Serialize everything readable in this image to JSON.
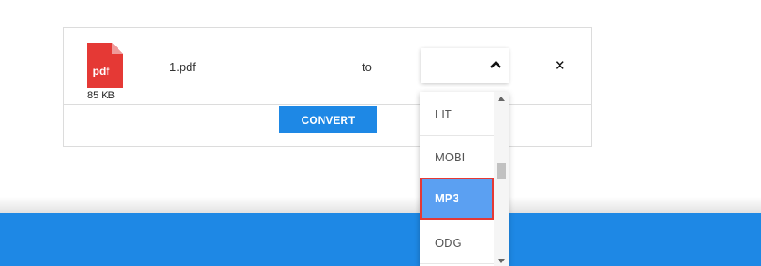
{
  "file": {
    "icon_label": "pdf",
    "name": "1.pdf",
    "size": "85 KB",
    "icon_color": "#e53935"
  },
  "conversion": {
    "to_label": "to",
    "convert_label": "CONVERT",
    "remove_label": "✕"
  },
  "dropdown": {
    "options": [
      "LIT",
      "MOBI",
      "MP3",
      "ODG"
    ],
    "selected": "MP3"
  },
  "colors": {
    "accent": "#1e88e5",
    "selected_option": "#5ba0f2",
    "highlight_outline": "#e53935"
  }
}
